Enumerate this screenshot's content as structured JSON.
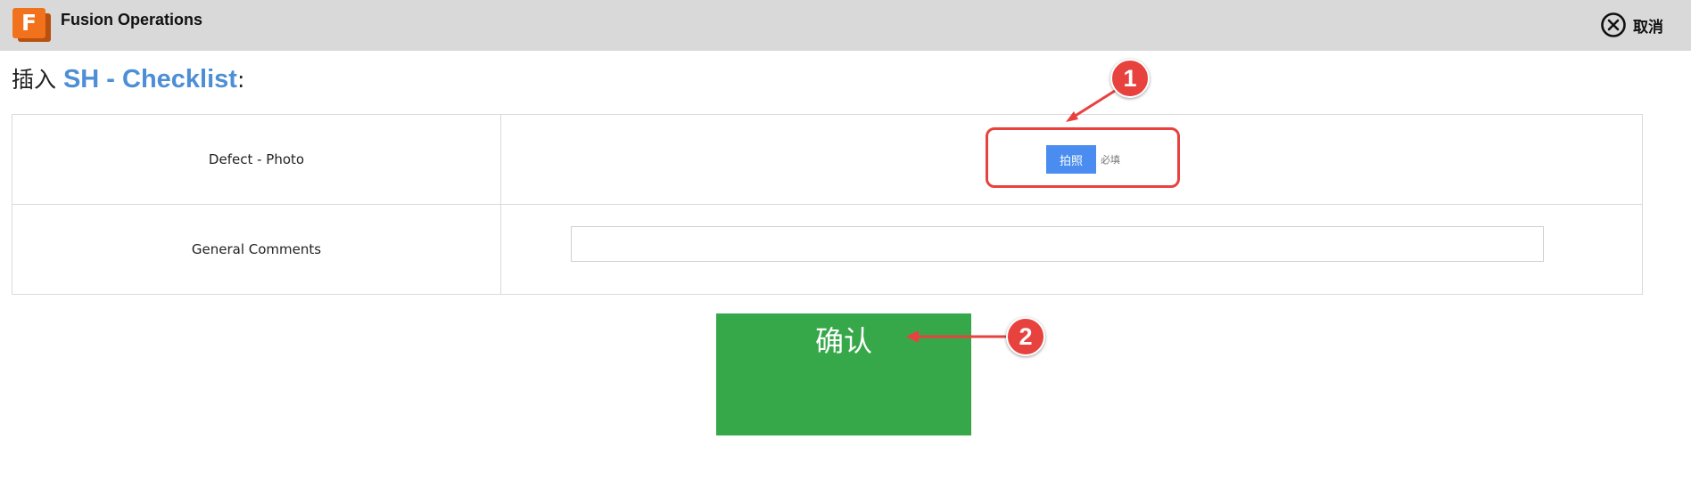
{
  "header": {
    "app_title": "Fusion Operations",
    "logo_letter": "F",
    "cancel_label": "取消",
    "logo_color": "#f2711c"
  },
  "heading": {
    "prefix": "插入 ",
    "form_name": "SH - Checklist",
    "suffix": ":"
  },
  "form": {
    "rows": [
      {
        "label": "Defect - Photo",
        "button_label": "拍照",
        "required_label": "必填"
      },
      {
        "label": "General Comments",
        "value": ""
      }
    ]
  },
  "confirm_label": "确认",
  "annotations": {
    "badge1": "1",
    "badge2": "2",
    "color": "#e8423f"
  }
}
